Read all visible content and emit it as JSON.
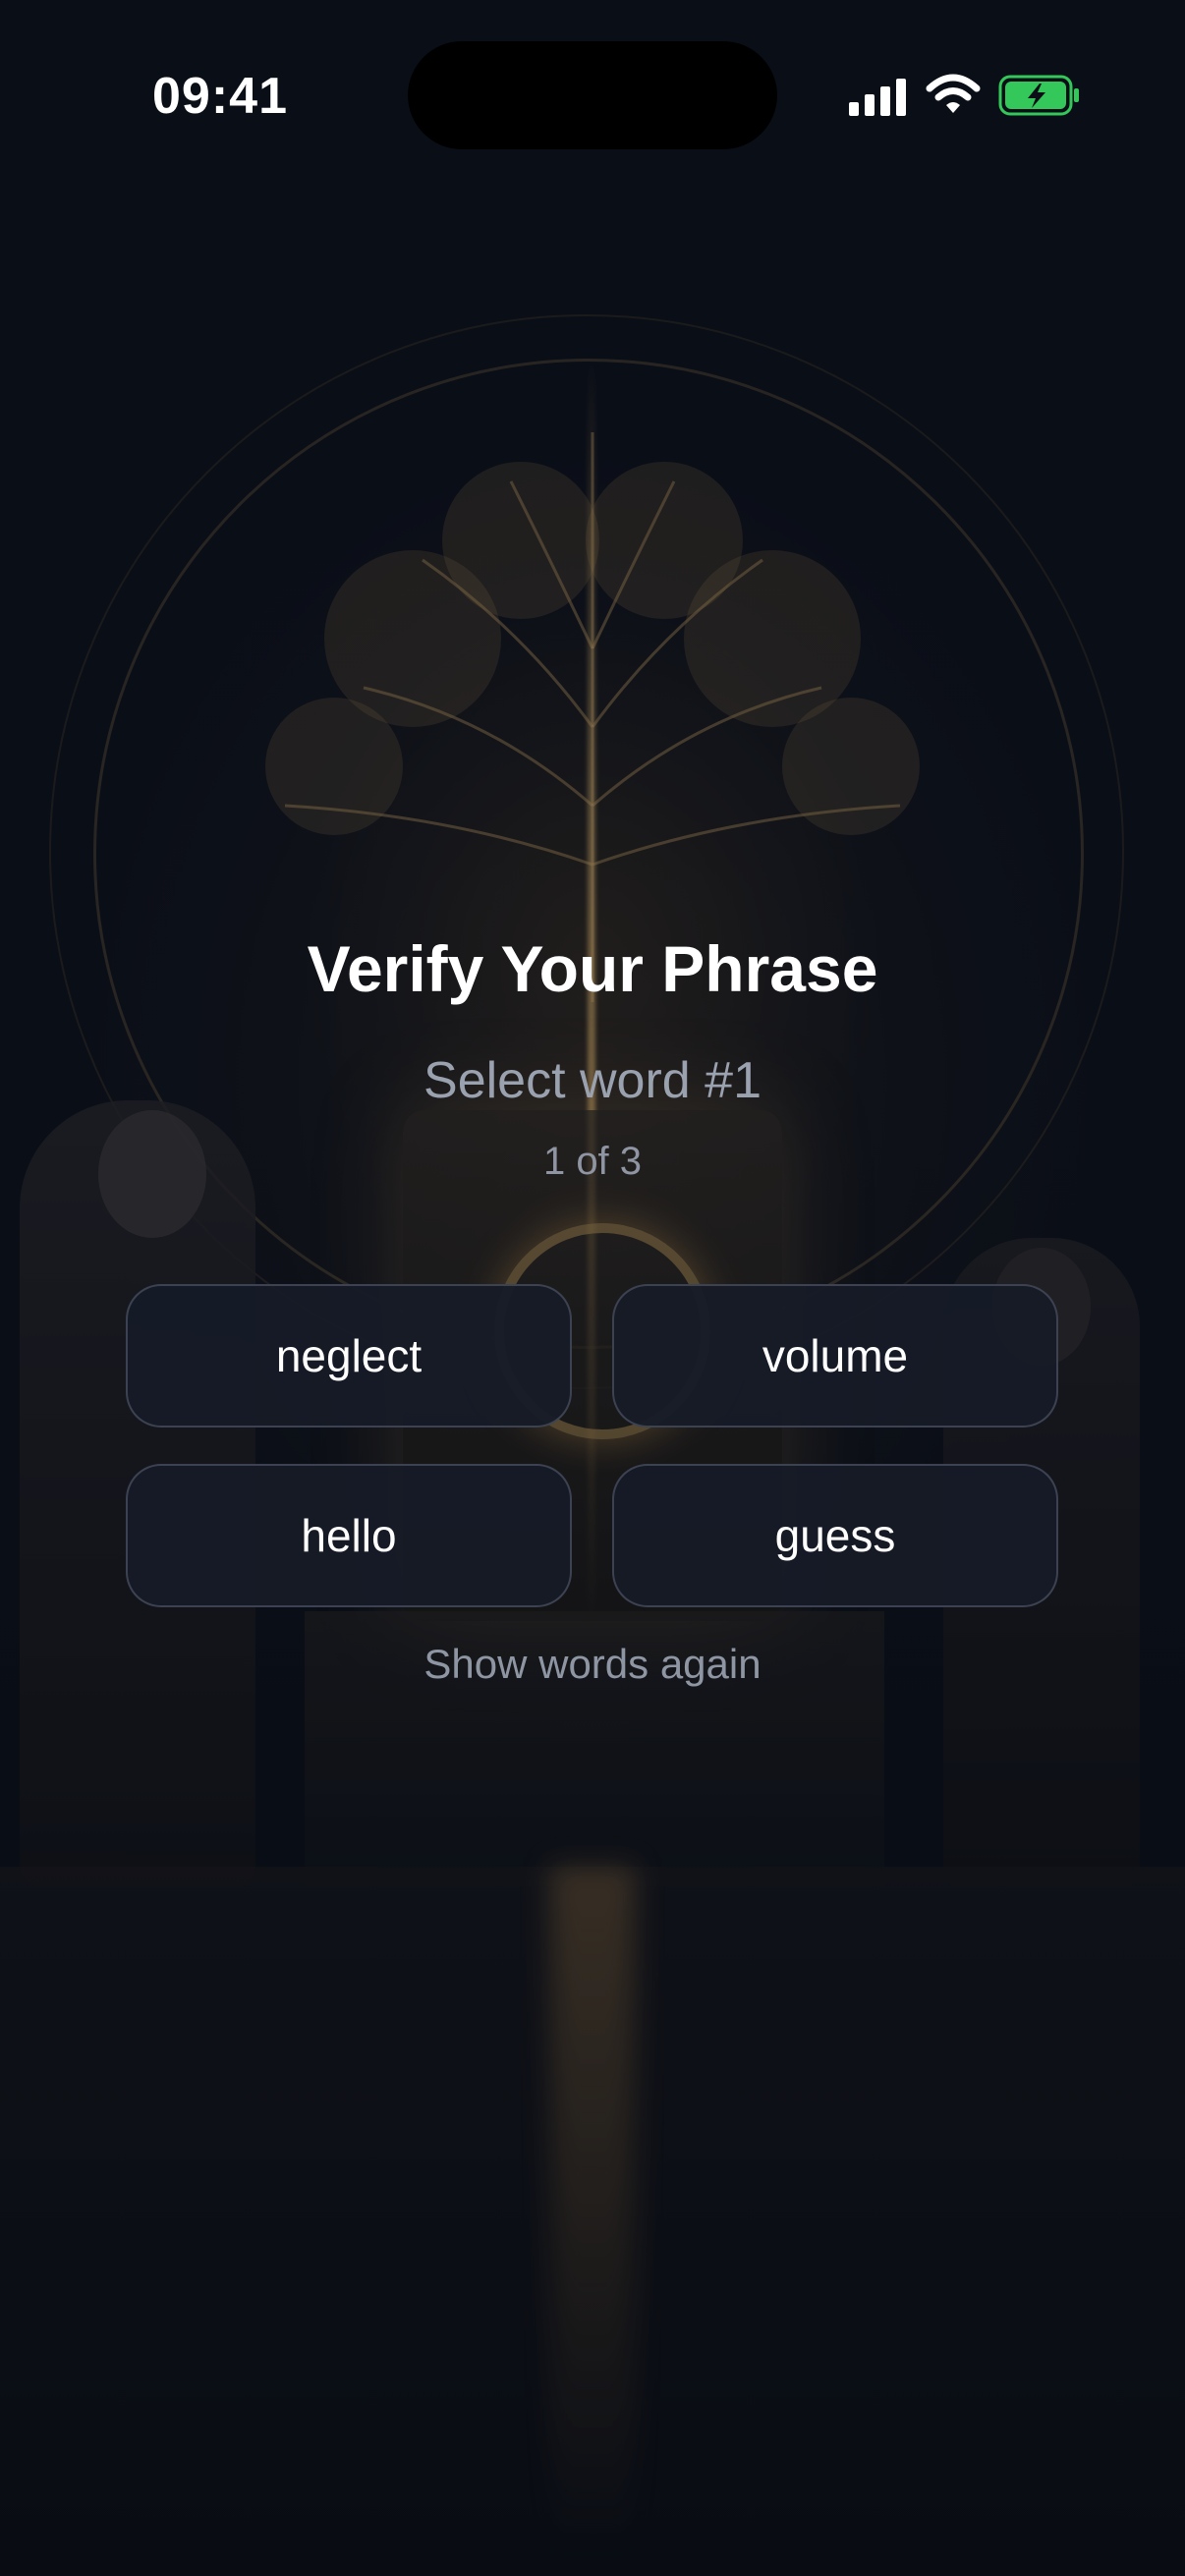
{
  "status_bar": {
    "time": "09:41",
    "icons": [
      "signal-icon",
      "wifi-icon",
      "battery-charging-icon"
    ],
    "battery_color": "#34c759"
  },
  "verify": {
    "title": "Verify Your Phrase",
    "subtitle": "Select word #1",
    "progress": "1 of 3",
    "options": [
      "neglect",
      "volume",
      "hello",
      "guess"
    ],
    "show_again": "Show words again"
  },
  "colors": {
    "background": "#0b0e16",
    "button_bg": "#161b27",
    "muted_text": "#9aa1af"
  }
}
